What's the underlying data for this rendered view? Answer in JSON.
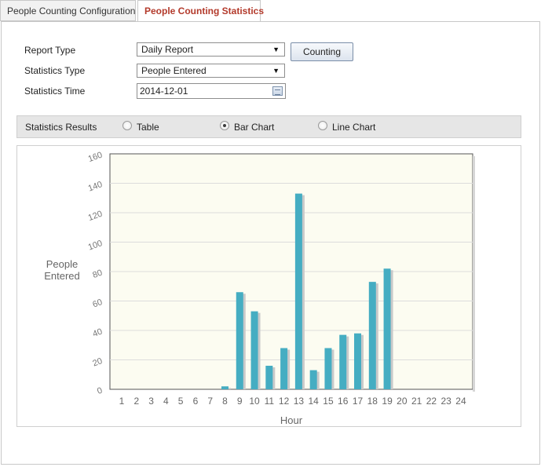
{
  "tabs": [
    {
      "label": "People Counting Configuration",
      "active": false
    },
    {
      "label": "People Counting Statistics",
      "active": true
    }
  ],
  "form": {
    "report_type_label": "Report Type",
    "report_type_value": "Daily Report",
    "statistics_type_label": "Statistics Type",
    "statistics_type_value": "People Entered",
    "statistics_time_label": "Statistics Time",
    "statistics_time_value": "2014-12-01",
    "counting_button": "Counting"
  },
  "results": {
    "label": "Statistics Results",
    "options": [
      {
        "label": "Table",
        "checked": false
      },
      {
        "label": "Bar Chart",
        "checked": true
      },
      {
        "label": "Line Chart",
        "checked": false
      }
    ]
  },
  "colors": {
    "active_tab_text": "#b33a2b",
    "bar": "#45adc2",
    "bar_shadow": "#c9c9c9",
    "plot_background": "#fcfcf1"
  },
  "chart_data": {
    "type": "bar",
    "xlabel": "Hour",
    "ylabel": "People Entered",
    "ylim": [
      0,
      160
    ],
    "yticks": [
      0,
      20,
      40,
      60,
      80,
      100,
      120,
      140,
      160
    ],
    "grid": true,
    "categories": [
      "1",
      "2",
      "3",
      "4",
      "5",
      "6",
      "7",
      "8",
      "9",
      "10",
      "11",
      "12",
      "13",
      "14",
      "15",
      "16",
      "17",
      "18",
      "19",
      "20",
      "21",
      "22",
      "23",
      "24"
    ],
    "values": [
      0,
      0,
      0,
      0,
      0,
      0,
      0,
      2,
      66,
      53,
      16,
      28,
      133,
      13,
      28,
      37,
      38,
      73,
      82,
      0,
      0,
      0,
      0,
      0
    ]
  }
}
